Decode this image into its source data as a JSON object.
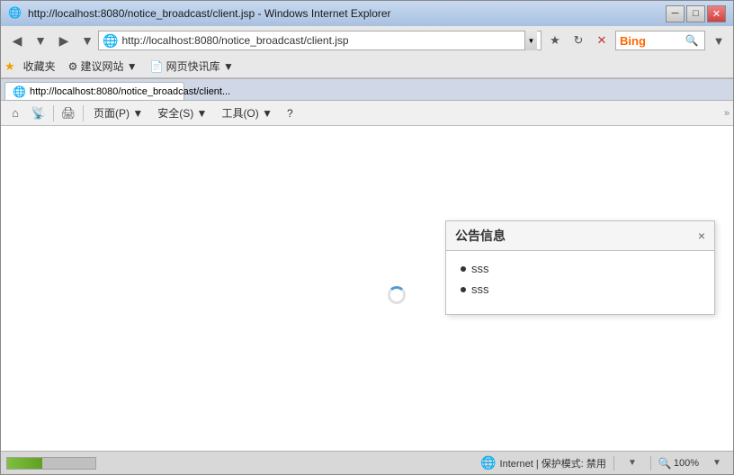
{
  "window": {
    "title": "http://localhost:8080/notice_broadcast/client.jsp - Windows Internet Explorer",
    "icon": "🌐"
  },
  "title_bar": {
    "min_label": "─",
    "max_label": "□",
    "close_label": "✕"
  },
  "nav_bar": {
    "back_label": "◀",
    "forward_label": "▶",
    "back_arrow": "▼",
    "address_url": "http://localhost:8080/notice_broadcast/client.jsp",
    "refresh_label": "↻",
    "stop_label": "✕",
    "bing_label": "Bing",
    "search_label": "🔍"
  },
  "favbar": {
    "favorites_label": "收藏夹",
    "item1_label": "建议网站 ▼",
    "item2_label": "网页快讯库 ▼"
  },
  "tab": {
    "label": "http://localhost:8080/notice_broadcast/client...",
    "new_tab_label": "+"
  },
  "cmdbar": {
    "home_label": "⌂",
    "rss_label": "RSS",
    "print_label": "🖨",
    "page_label": "页面(P) ▼",
    "safety_label": "安全(S) ▼",
    "tools_label": "工具(O) ▼",
    "help_label": "?"
  },
  "notice": {
    "title": "公告信息",
    "close_label": "×",
    "items": [
      {
        "text": "sss"
      },
      {
        "text": "sss"
      }
    ]
  },
  "status_bar": {
    "zone_label": "Internet | 保护模式: 禁用",
    "zoom_label": "100%",
    "zoom_icon": "🔍"
  }
}
